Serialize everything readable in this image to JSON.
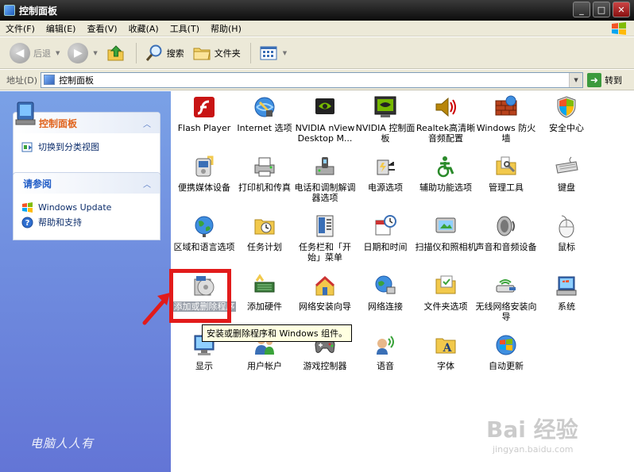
{
  "window": {
    "title": "控制面板"
  },
  "window_buttons": [
    "_",
    "□",
    "✕"
  ],
  "menu": [
    "文件(F)",
    "编辑(E)",
    "查看(V)",
    "收藏(A)",
    "工具(T)",
    "帮助(H)"
  ],
  "toolbar": {
    "back": "后退",
    "search": "搜索",
    "folders": "文件夹"
  },
  "address": {
    "label": "地址(D)",
    "value": "控制面板",
    "go": "转到"
  },
  "sidebar": {
    "panel1": {
      "title": "控制面板",
      "link": "切换到分类视图"
    },
    "panel2": {
      "title": "请参阅",
      "links": [
        "Windows Update",
        "帮助和支持"
      ]
    }
  },
  "items": [
    {
      "label": "Flash Player",
      "icon": "flash-player-icon"
    },
    {
      "label": "Internet 选项",
      "icon": "internet-options-icon"
    },
    {
      "label": "NVIDIA nView Desktop M...",
      "icon": "nvidia-nview-icon"
    },
    {
      "label": "NVIDIA 控制面板",
      "icon": "nvidia-control-panel-icon"
    },
    {
      "label": "Realtek高清晰音频配置",
      "icon": "realtek-audio-icon"
    },
    {
      "label": "Windows 防火墙",
      "icon": "firewall-icon"
    },
    {
      "label": "安全中心",
      "icon": "security-center-icon"
    },
    {
      "label": "便携媒体设备",
      "icon": "portable-media-icon"
    },
    {
      "label": "打印机和传真",
      "icon": "printers-icon"
    },
    {
      "label": "电话和调制解调器选项",
      "icon": "phone-modem-icon"
    },
    {
      "label": "电源选项",
      "icon": "power-options-icon"
    },
    {
      "label": "辅助功能选项",
      "icon": "accessibility-icon"
    },
    {
      "label": "管理工具",
      "icon": "admin-tools-icon"
    },
    {
      "label": "键盘",
      "icon": "keyboard-icon"
    },
    {
      "label": "区域和语言选项",
      "icon": "regional-language-icon"
    },
    {
      "label": "任务计划",
      "icon": "scheduled-tasks-icon"
    },
    {
      "label": "任务栏和「开始」菜单",
      "icon": "taskbar-start-menu-icon"
    },
    {
      "label": "日期和时间",
      "icon": "date-time-icon"
    },
    {
      "label": "扫描仪和照相机",
      "icon": "scanner-camera-icon"
    },
    {
      "label": "声音和音频设备",
      "icon": "sound-icon"
    },
    {
      "label": "鼠标",
      "icon": "mouse-icon"
    },
    {
      "label": "添加或删除程序",
      "icon": "add-remove-programs-icon"
    },
    {
      "label": "添加硬件",
      "icon": "add-hardware-icon"
    },
    {
      "label": "网络安装向导",
      "icon": "network-setup-icon"
    },
    {
      "label": "网络连接",
      "icon": "network-connections-icon"
    },
    {
      "label": "文件夹选项",
      "icon": "folder-options-icon"
    },
    {
      "label": "无线网络安装向导",
      "icon": "wireless-setup-icon"
    },
    {
      "label": "系统",
      "icon": "system-icon"
    },
    {
      "label": "显示",
      "icon": "display-icon"
    },
    {
      "label": "用户帐户",
      "icon": "user-accounts-icon"
    },
    {
      "label": "游戏控制器",
      "icon": "game-controllers-icon"
    },
    {
      "label": "语音",
      "icon": "speech-icon"
    },
    {
      "label": "字体",
      "icon": "fonts-icon"
    },
    {
      "label": "自动更新",
      "icon": "automatic-updates-icon"
    }
  ],
  "tooltip": "安装或删除程序和 Windows 组件。",
  "watermarks": {
    "left": "电脑人人有",
    "right_big": "Bai 经验",
    "right_small": "jingyan.baidu.com"
  }
}
